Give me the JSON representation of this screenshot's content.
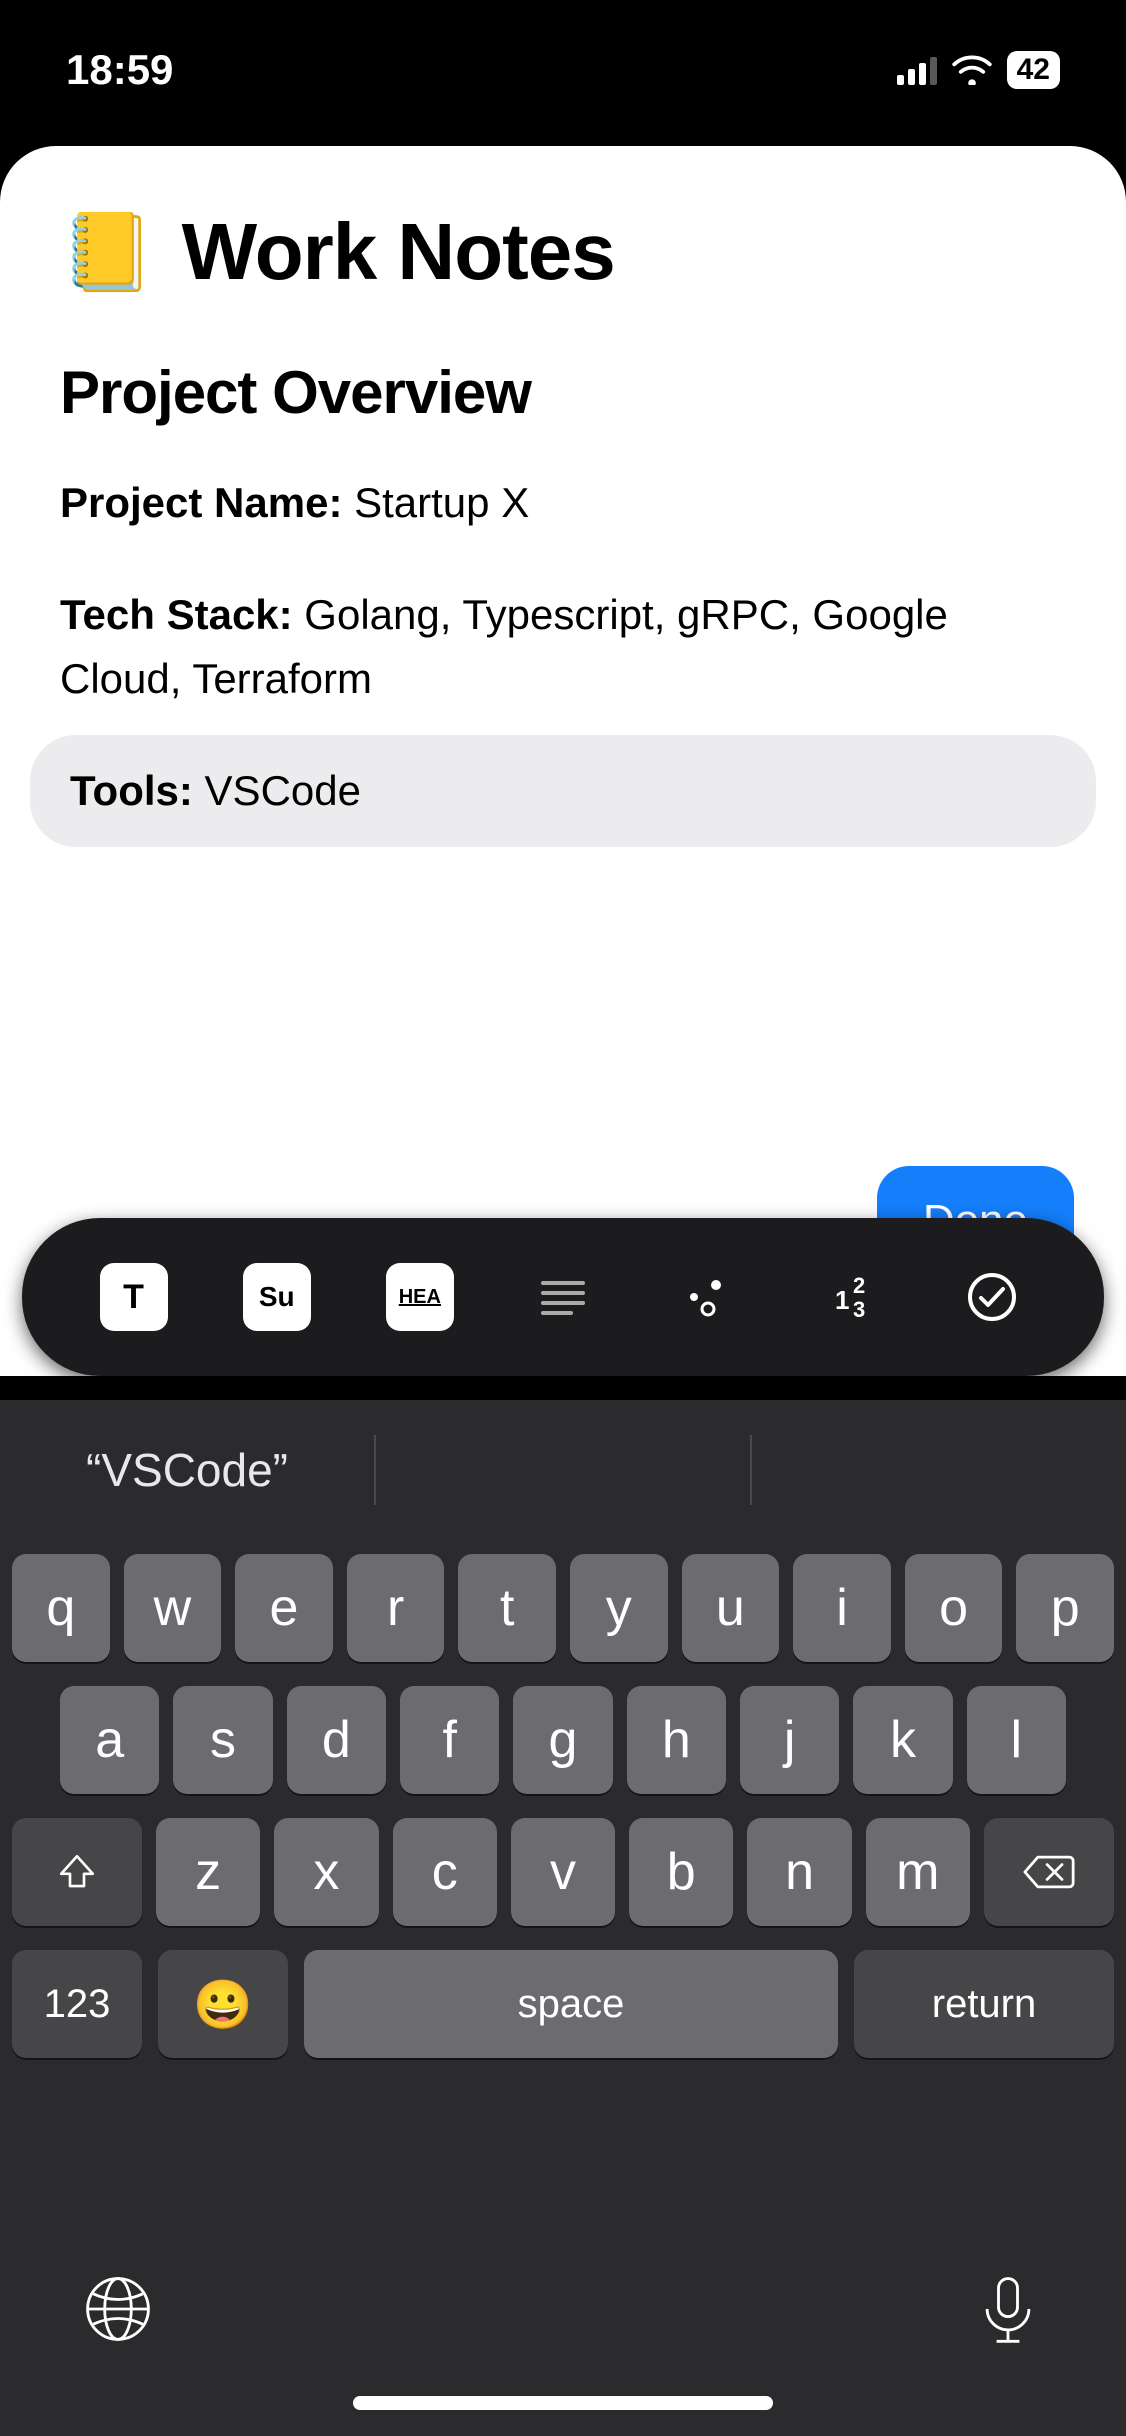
{
  "status": {
    "time": "18:59",
    "battery": "42"
  },
  "note": {
    "emoji": "📒",
    "title": "Work Notes",
    "section_heading": "Project Overview",
    "project_name_label": "Project Name:",
    "project_name_value": " Startup X",
    "tech_stack_label": "Tech Stack:",
    "tech_stack_value": " Golang, Typescript, gRPC, Google Cloud, Terraform",
    "tools_label": "Tools:",
    "tools_value": " VSCode"
  },
  "done_button": "Done",
  "format_bar": {
    "text_style": "T",
    "sub": "Su",
    "heading": "HEA"
  },
  "suggestion": {
    "left": "“VSCode”",
    "center": "",
    "right": ""
  },
  "keys": {
    "row1": [
      "q",
      "w",
      "e",
      "r",
      "t",
      "y",
      "u",
      "i",
      "o",
      "p"
    ],
    "row2": [
      "a",
      "s",
      "d",
      "f",
      "g",
      "h",
      "j",
      "k",
      "l"
    ],
    "row3": [
      "z",
      "x",
      "c",
      "v",
      "b",
      "n",
      "m"
    ],
    "num": "123",
    "space": "space",
    "return": "return"
  }
}
